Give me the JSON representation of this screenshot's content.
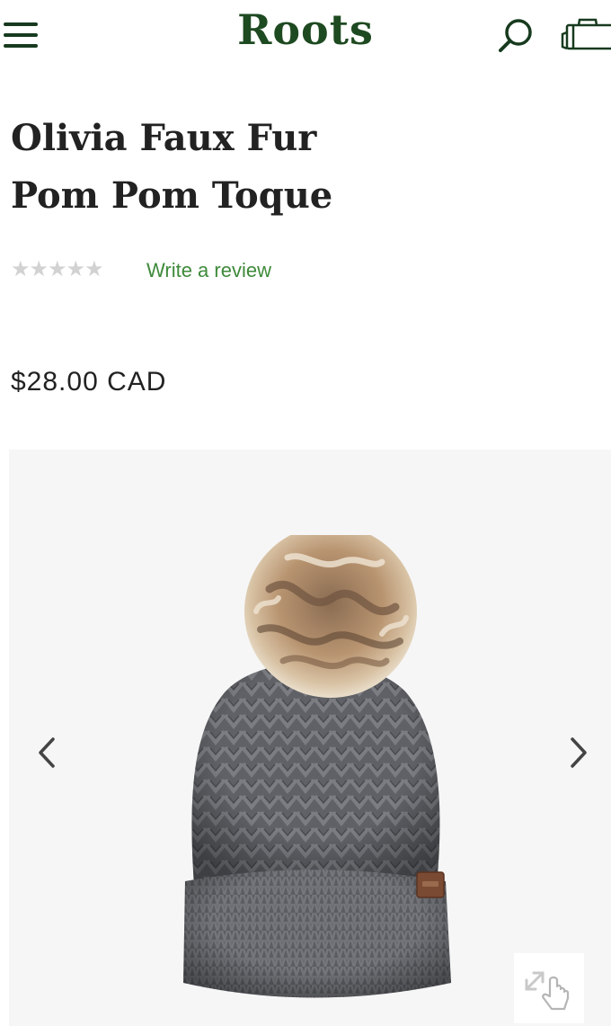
{
  "header": {
    "brand": "Roots",
    "icons": {
      "menu": "hamburger-menu-icon",
      "search": "search-icon",
      "cart": "shopping-bag-icon"
    },
    "brand_color": "#1e4a21"
  },
  "product": {
    "title_line1": "Olivia Faux Fur",
    "title_line2": "Pom Pom Toque",
    "rating_stars": 0,
    "rating_max": 5,
    "review_link": "Write a review",
    "price": "$28.00 CAD"
  },
  "gallery": {
    "image_subject": "grey knit toque with faux fur pom pom",
    "icons": {
      "prev": "chevron-left-icon",
      "next": "chevron-right-icon",
      "zoom": "pinch-zoom-icon"
    }
  },
  "colors": {
    "link": "#3e8a3a",
    "star_empty": "#d2d2d2",
    "text": "#222222"
  }
}
